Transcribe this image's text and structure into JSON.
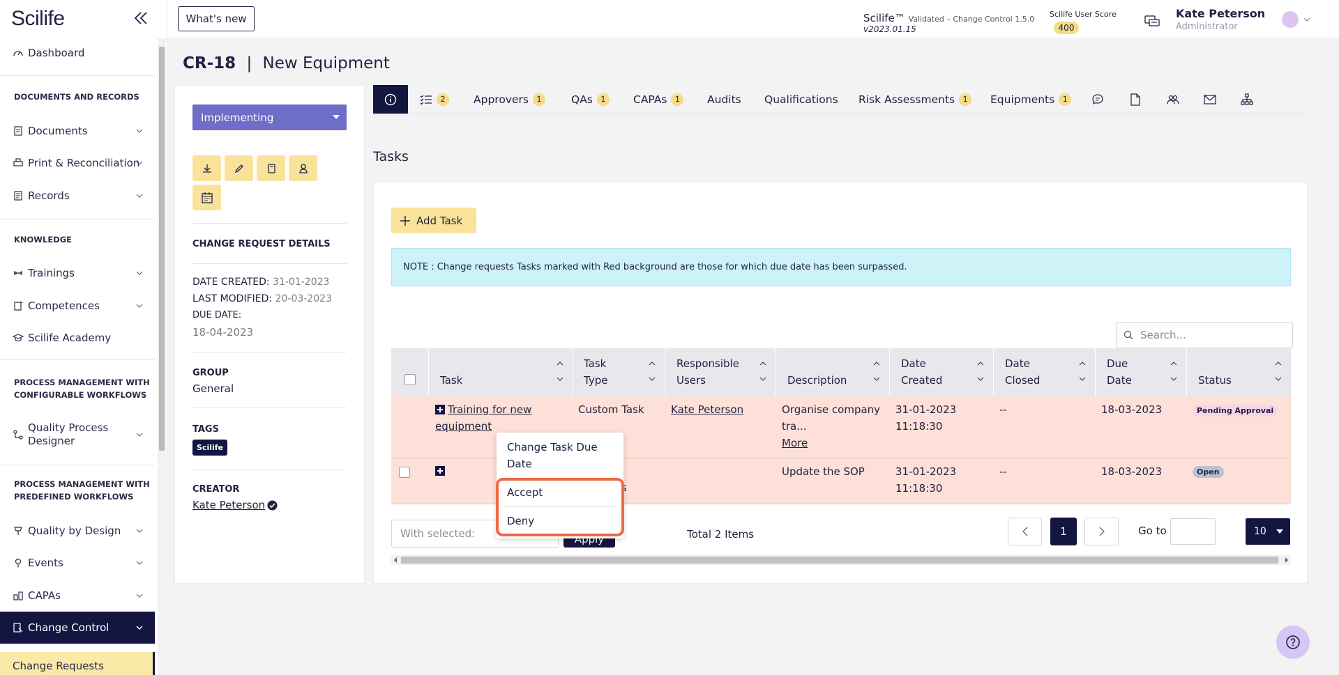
{
  "brand": {
    "logo": "Scilife"
  },
  "sidebar": {
    "items": [
      {
        "label": "Dashboard"
      },
      {
        "label": "Documents"
      },
      {
        "label": "Print & Reconciliation"
      },
      {
        "label": "Records"
      },
      {
        "label": "Trainings"
      },
      {
        "label": "Competences"
      },
      {
        "label": "Scilife Academy"
      },
      {
        "label": "Quality Process Designer"
      },
      {
        "label": "Quality by Design"
      },
      {
        "label": "Events"
      },
      {
        "label": "CAPAs"
      },
      {
        "label": "Change Control"
      },
      {
        "label": "Change Requests"
      }
    ],
    "headings": [
      "DOCUMENTS AND RECORDS",
      "KNOWLEDGE",
      "PROCESS MANAGEMENT WITH CONFIGURABLE WORKFLOWS",
      "PROCESS MANAGEMENT WITH PREDEFINED WORKFLOWS"
    ]
  },
  "topbar": {
    "whats_new": "What's new",
    "product": "Scilife™",
    "product_sub": "Validated – Change Control 1.5.0",
    "version": "v2023.01.15",
    "score_label": "Scilife User Score",
    "score": "400",
    "user_name": "Kate Peterson",
    "user_role": "Administrator"
  },
  "page": {
    "id": "CR-18",
    "separator": "|",
    "title": "New Equipment"
  },
  "details": {
    "status": "Implementing",
    "section_title": "CHANGE REQUEST DETAILS",
    "date_created_label": "DATE CREATED:",
    "date_created": "31-01-2023",
    "last_modified_label": "LAST MODIFIED:",
    "last_modified": "20-03-2023",
    "due_date_label": "DUE DATE:",
    "due_date": "18-04-2023",
    "group_label": "GROUP",
    "group": "General",
    "tags_label": "TAGS",
    "tag": "Scilife",
    "creator_label": "CREATOR",
    "creator": "Kate Peterson"
  },
  "tabs": [
    {
      "label": "",
      "badge": "2"
    },
    {
      "label": "Approvers",
      "badge": "1"
    },
    {
      "label": "QAs",
      "badge": "1"
    },
    {
      "label": "CAPAs",
      "badge": "1"
    },
    {
      "label": "Audits"
    },
    {
      "label": "Qualifications"
    },
    {
      "label": "Risk Assessments",
      "badge": "1"
    },
    {
      "label": "Equipments",
      "badge": "1"
    }
  ],
  "tasks": {
    "title": "Tasks",
    "add_task": "Add Task",
    "note": "NOTE : Change requests Tasks marked with Red background are those for which due date has been surpassed.",
    "search_placeholder": "Search...",
    "columns": [
      "Task",
      "Task Type",
      "Responsible Users",
      "Description",
      "Date Created",
      "Date Closed",
      "Due Date",
      "Status"
    ],
    "rows": [
      {
        "task": "Training for new equipment",
        "type": "Custom Task",
        "responsible": "Kate Peterson",
        "description": "Organise company tra...",
        "more": "More",
        "created": "31-01-2023 11:18:30",
        "closed": "--",
        "due": "18-03-2023",
        "status": "Pending Approval"
      },
      {
        "task": "",
        "type": "...nts",
        "responsible": "",
        "description": "Update the SOP",
        "created": "31-01-2023 11:18:30",
        "closed": "--",
        "due": "18-03-2023",
        "status": "Open"
      }
    ],
    "with_selected": "With selected:",
    "apply": "Apply",
    "total": "Total 2 Items",
    "page": "1",
    "goto": "Go to",
    "page_size": "10"
  },
  "context_menu": {
    "change_due": "Change Task Due Date",
    "accept": "Accept",
    "deny": "Deny"
  },
  "colors": {
    "accent": "#121640",
    "highlight": "#fbe29b",
    "overdue": "#fde0d7",
    "status": "#6e6dc7"
  }
}
